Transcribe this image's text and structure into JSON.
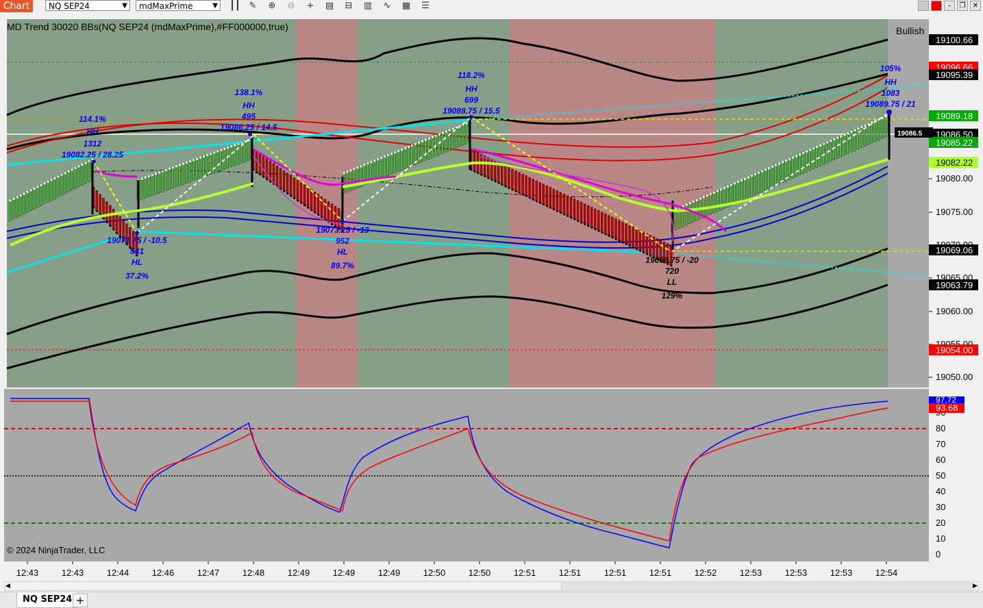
{
  "toolbar": {
    "chart_tab": "Chart",
    "instrument": "NQ SEP24",
    "template": "mdMaxPrime",
    "icons": [
      "bar-style-icon",
      "draw-icon",
      "zoom-in-icon",
      "zoom-out-icon",
      "crosshair-icon",
      "data-box-icon",
      "properties-icon",
      "strategies-icon",
      "indicators-icon",
      "calendar-icon",
      "menu-icon"
    ]
  },
  "window": {
    "buttons": [
      "minimize",
      "restore",
      "close"
    ]
  },
  "indicator_label": "MD Trend 30020 BBs(NQ SEP24 (mdMaxPrime),#FF000000,true)",
  "bias_label": "Bullish",
  "copyright": "© 2024 NinjaTrader, LLC",
  "colors": {
    "bg_green": "#889f87",
    "bg_red": "#b98886",
    "lower_bg": "#a8a8a8",
    "blue": "#0000ff",
    "red": "#ff0000",
    "cyan": "#00e5ee",
    "lime": "#b6ff30",
    "magenta": "#e000e0"
  },
  "price_scale": {
    "ticks": [
      "19100.66",
      "19080.00",
      "19075.00",
      "19070.00",
      "19065.00",
      "19060.00",
      "19055.00",
      "19050.00"
    ],
    "badges": [
      {
        "text": "19100.66",
        "color": "#000000"
      },
      {
        "text": "19096.66",
        "color": "#ff0000"
      },
      {
        "text": "19095.39",
        "color": "#000000"
      },
      {
        "text": "19089.18",
        "color": "#00aa00"
      },
      {
        "text": "19086.50",
        "color": "#000000"
      },
      {
        "text": "19085.22",
        "color": "#00aa00"
      },
      {
        "text": "19082.22",
        "color": "#adff2f"
      },
      {
        "text": "19069.06",
        "color": "#000000"
      },
      {
        "text": "19063.79",
        "color": "#000000"
      },
      {
        "text": "19054.00",
        "color": "#ff0000"
      }
    ],
    "cursor_price": "19086.5"
  },
  "swings": [
    {
      "pct": "114.1%",
      "type": "HH",
      "count": "1312",
      "price": "19082.25 / 28.25"
    },
    {
      "pct": "37.2%",
      "type": "HL",
      "count": "541",
      "price": "19071.75 / -10.5"
    },
    {
      "pct": "138.1%",
      "type": "HH",
      "count": "495",
      "price": "19086.25 / 14.5"
    },
    {
      "pct": "89.7%",
      "type": "HL",
      "count": "952",
      "price": "19073.25 / -13"
    },
    {
      "pct": "118.2%",
      "type": "HH",
      "count": "699",
      "price": "19088.75 / 15.5"
    },
    {
      "pct": "129%",
      "type": "LL",
      "count": "720",
      "price": "19068.75 / -20"
    },
    {
      "pct": "105%",
      "type": "HH",
      "count": "1083",
      "price": "19089.75 / 21"
    }
  ],
  "oscillator": {
    "ticks": [
      "90",
      "80",
      "70",
      "60",
      "50",
      "40",
      "30",
      "20",
      "10",
      "0"
    ],
    "badges": [
      {
        "text": "97.72",
        "color": "#0000ff"
      },
      {
        "text": "93.68",
        "color": "#ff0000"
      }
    ],
    "upper_level": 80,
    "mid_level": 50,
    "lower_level": 20
  },
  "time_axis": [
    "12:43",
    "12:43",
    "12:44",
    "12:46",
    "12:47",
    "12:48",
    "12:49",
    "12:49",
    "12:49",
    "12:50",
    "12:50",
    "12:51",
    "12:51",
    "12:51",
    "12:51",
    "12:52",
    "12:53",
    "12:53",
    "12:53",
    "12:54"
  ],
  "bottom_tabs": {
    "active": "NQ SEP24",
    "add": "+"
  }
}
